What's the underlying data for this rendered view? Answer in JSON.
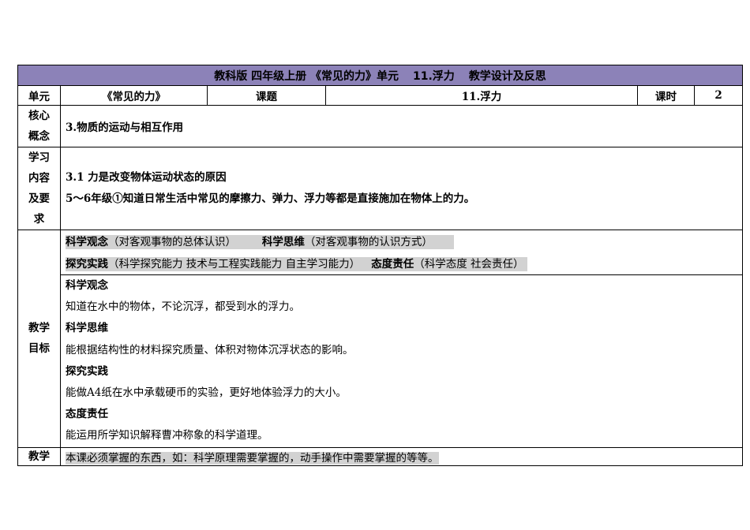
{
  "header": {
    "title_a": "教科版  四年级上册 《常见的力》单元",
    "title_b": "11.浮力",
    "title_c": "教学设计及反思"
  },
  "info": {
    "unit_label": "单元",
    "unit_value": "《常见的力》",
    "topic_label": "课题",
    "topic_value": "11.浮力",
    "period_label": "课时",
    "period_value": "2"
  },
  "core": {
    "label_1": "核心",
    "label_2": "概念",
    "value": "3.物质的运动与相互作用"
  },
  "learning": {
    "label_1": "学习",
    "label_2": "内容",
    "label_3": "及要",
    "label_4": "求",
    "line_1": "3.1 力是改变物体运动状态的原因",
    "line_2": "5～6年级①知道日常生活中常见的摩擦力、弹力、浮力等都是直接施加在物体上的力。"
  },
  "goals": {
    "label_1": "教学",
    "label_2": "目标",
    "tag_1_title": "科学观念",
    "tag_1_desc": "（对客观事物的总体认识）",
    "tag_2_title": "科学思维",
    "tag_2_desc": "（对客观事物的认识方式）",
    "tag_3_title": "探究实践",
    "tag_3_desc": "（科学探究能力 技术与工程实践能力 自主学习能力）",
    "tag_4_title": "态度责任",
    "tag_4_desc": "（科学态度 社会责任）",
    "items": [
      {
        "heading": "科学观念",
        "text": "知道在水中的物体，不论沉浮，都受到水的浮力。"
      },
      {
        "heading": "科学思维",
        "text": "能根据结构性的材料探究质量、体积对物体沉浮状态的影响。"
      },
      {
        "heading": "探究实践",
        "text": "能做A4纸在水中承载硬币的实验，更好地体验浮力的大小。"
      },
      {
        "heading": "态度责任",
        "text": "能运用所学知识解释曹冲称象的科学道理。"
      }
    ]
  },
  "last": {
    "label": "教学",
    "text": "本课必须掌握的东西，如：科学原理需要掌握的，动手操作中需要掌握的等等。"
  }
}
